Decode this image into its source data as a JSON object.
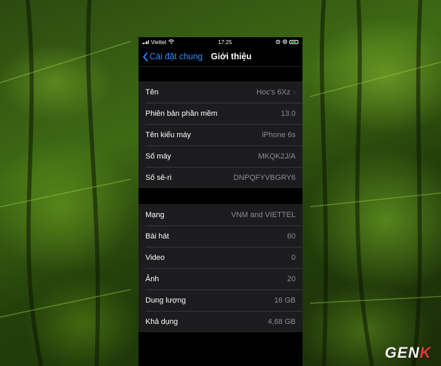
{
  "status_bar": {
    "carrier": "Viettel",
    "time": "17:25"
  },
  "nav": {
    "back_label": "Cài đặt chung",
    "title": "Giới thiệu"
  },
  "groups": [
    {
      "rows": [
        {
          "label": "Tên",
          "value": "Hoc's 6Xz",
          "chevron": true
        },
        {
          "label": "Phiên bản phần mềm",
          "value": "13.0"
        },
        {
          "label": "Tên kiểu máy",
          "value": "iPhone 6s"
        },
        {
          "label": "Số máy",
          "value": "MKQK2J/A"
        },
        {
          "label": "Số sê-ri",
          "value": "DNPQFYVBGRY6"
        }
      ]
    },
    {
      "rows": [
        {
          "label": "Mạng",
          "value": "VNM and VIETTEL"
        },
        {
          "label": "Bài hát",
          "value": "60"
        },
        {
          "label": "Video",
          "value": "0"
        },
        {
          "label": "Ảnh",
          "value": "20"
        },
        {
          "label": "Dung lượng",
          "value": "16 GB"
        },
        {
          "label": "Khả dụng",
          "value": "4,68 GB"
        }
      ]
    }
  ],
  "watermark": {
    "text_main": "GEN",
    "text_accent": "K"
  },
  "colors": {
    "accent_link": "#2f8cff",
    "battery": "#37d04a",
    "watermark_accent": "#e53935"
  }
}
